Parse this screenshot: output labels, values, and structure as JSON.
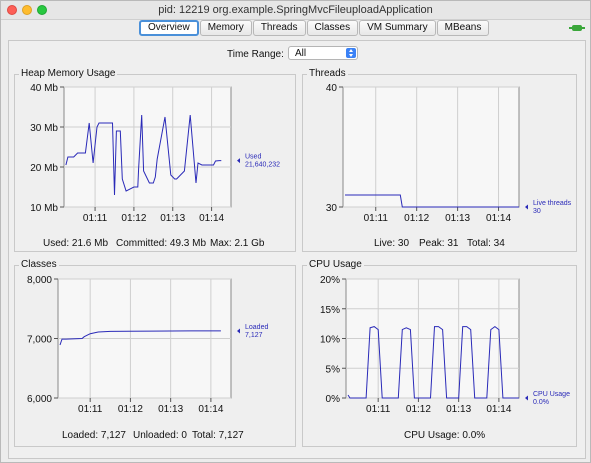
{
  "window": {
    "title": "pid: 12219 org.example.SpringMvcFileuploadApplication"
  },
  "tabs": [
    "Overview",
    "Memory",
    "Threads",
    "Classes",
    "VM Summary",
    "MBeans"
  ],
  "active_tab": "Overview",
  "time_range": {
    "label": "Time Range:",
    "value": "All"
  },
  "panels": {
    "heap": {
      "title": "Heap Memory Usage",
      "footer": {
        "used": "Used: 21.6 Mb",
        "committed": "Committed: 49.3 Mb",
        "max": "Max: 2.1 Gb"
      }
    },
    "threads": {
      "title": "Threads",
      "footer": {
        "live": "Live: 30",
        "peak": "Peak: 31",
        "total": "Total: 34"
      }
    },
    "classes": {
      "title": "Classes",
      "footer": {
        "loaded": "Loaded: 7,127",
        "unloaded": "Unloaded: 0",
        "total": "Total: 7,127"
      }
    },
    "cpu": {
      "title": "CPU Usage",
      "footer": {
        "usage": "CPU Usage: 0.0%"
      }
    }
  },
  "colors": {
    "series": "#2a2ab8",
    "tab_focus": "#4a90d9"
  },
  "chart_data": [
    {
      "type": "line",
      "name": "heap",
      "yticks": [
        "40 Mb",
        "30 Mb",
        "20 Mb",
        "10 Mb"
      ],
      "ytick_values": [
        40,
        30,
        20,
        10
      ],
      "ylim": [
        10,
        40
      ],
      "xticks": [
        "01:11",
        "01:12",
        "01:13",
        "01:14"
      ],
      "xtick_values": [
        1.5,
        2.5,
        3.5,
        4.5
      ],
      "xlim": [
        0.7,
        5.0
      ],
      "grid": true,
      "series": [
        {
          "name": "Used",
          "value_label": "21,640,232",
          "x": [
            0.75,
            0.8,
            0.95,
            1.05,
            1.25,
            1.35,
            1.45,
            1.55,
            1.6,
            1.65,
            1.72,
            1.95,
            2.0,
            2.05,
            2.15,
            2.2,
            2.3,
            2.5,
            2.6,
            2.62,
            2.7,
            2.75,
            2.9,
            3.0,
            3.05,
            3.1,
            3.3,
            3.45,
            3.55,
            3.6,
            3.8,
            3.95,
            4.1,
            4.15,
            4.25,
            4.45,
            4.55,
            4.6,
            4.7,
            4.75
          ],
          "values": [
            20.5,
            22.5,
            22.5,
            23.5,
            23.5,
            31,
            21,
            30,
            31,
            31,
            31,
            31,
            13,
            29,
            29,
            17,
            14,
            15,
            15,
            19.5,
            33,
            19,
            16,
            16,
            17.5,
            22,
            32.5,
            18,
            17,
            17,
            19,
            33,
            16,
            21,
            20.5,
            20.5,
            20.5,
            21.5,
            21.6,
            21.6
          ]
        }
      ]
    },
    {
      "type": "line",
      "name": "threads",
      "yticks": [
        "40",
        "30"
      ],
      "ytick_values": [
        40,
        30
      ],
      "ylim": [
        30,
        40
      ],
      "xticks": [
        "01:11",
        "01:12",
        "01:13",
        "01:14"
      ],
      "xtick_values": [
        1.5,
        2.5,
        3.5,
        4.5
      ],
      "xlim": [
        0.7,
        5.0
      ],
      "grid": true,
      "series": [
        {
          "name": "Live threads",
          "value_label": "30",
          "x": [
            0.75,
            2.1,
            2.15,
            5.0
          ],
          "values": [
            31,
            31,
            30,
            30
          ]
        }
      ]
    },
    {
      "type": "line",
      "name": "classes",
      "yticks": [
        "8,000",
        "7,000",
        "6,000"
      ],
      "ytick_values": [
        8000,
        7000,
        6000
      ],
      "ylim": [
        6000,
        8000
      ],
      "xticks": [
        "01:11",
        "01:12",
        "01:13",
        "01:14"
      ],
      "xtick_values": [
        1.5,
        2.5,
        3.5,
        4.5
      ],
      "xlim": [
        0.7,
        5.0
      ],
      "grid": true,
      "series": [
        {
          "name": "Loaded",
          "value_label": "7,127",
          "x": [
            0.75,
            0.8,
            0.9,
            1.3,
            1.35,
            1.5,
            1.7,
            2.0,
            3.0,
            4.0,
            4.75
          ],
          "values": [
            6890,
            6990,
            6990,
            7000,
            7030,
            7080,
            7110,
            7120,
            7125,
            7127,
            7127
          ]
        }
      ]
    },
    {
      "type": "line",
      "name": "cpu",
      "yticks": [
        "20%",
        "15%",
        "10%",
        "5%",
        "0%"
      ],
      "ytick_values": [
        20,
        15,
        10,
        5,
        0
      ],
      "ylim": [
        0,
        20
      ],
      "xticks": [
        "01:11",
        "01:12",
        "01:13",
        "01:14"
      ],
      "xtick_values": [
        1.5,
        2.5,
        3.5,
        4.5
      ],
      "xlim": [
        0.7,
        5.0
      ],
      "grid": true,
      "series": [
        {
          "name": "CPU Usage",
          "value_label": "0.0%",
          "x": [
            0.75,
            0.8,
            1.2,
            1.3,
            1.4,
            1.5,
            1.6,
            2.0,
            2.1,
            2.2,
            2.3,
            2.4,
            2.8,
            2.9,
            3.0,
            3.1,
            3.2,
            3.5,
            3.6,
            3.7,
            3.8,
            3.9,
            4.2,
            4.3,
            4.4,
            4.5,
            4.6,
            5.0
          ],
          "values": [
            0.5,
            0,
            0,
            11.8,
            12,
            11.5,
            0,
            0,
            11.5,
            11.8,
            11.5,
            0,
            0,
            12,
            12,
            11.5,
            0,
            0,
            12,
            12,
            11.5,
            0,
            0,
            11.5,
            12,
            11.5,
            0,
            0
          ]
        }
      ]
    }
  ]
}
